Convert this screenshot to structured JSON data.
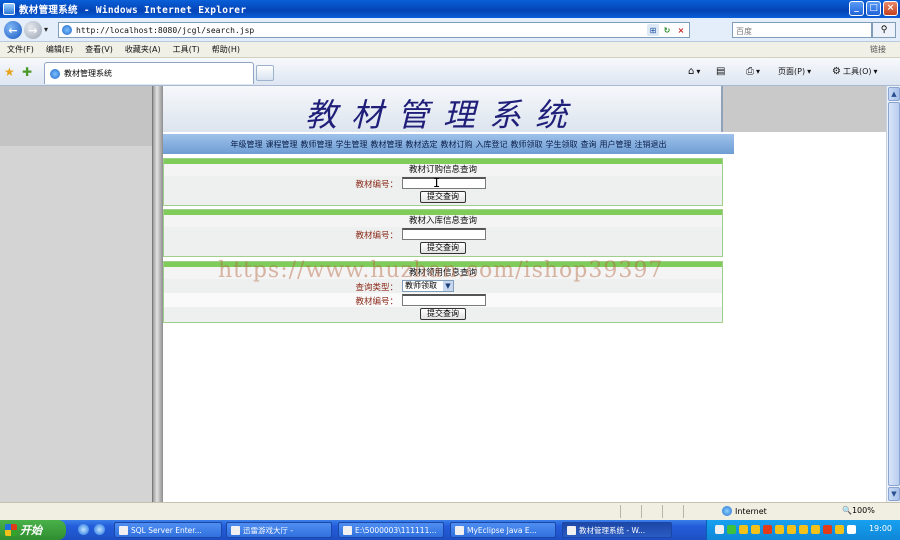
{
  "window": {
    "title": "教材管理系统 - Windows Internet Explorer",
    "minimize": "_",
    "maximize": "□",
    "close": "×"
  },
  "address": {
    "back": "←",
    "forward": "→",
    "dropdown": "▾",
    "url": "http://localhost:8080/jcgl/search.jsp",
    "search_placeholder": "百度",
    "search_button": "⚲",
    "refresh": "↻",
    "go": "→",
    "stop": "×",
    "compat": "⊞"
  },
  "menu": {
    "items": [
      "文件(F)",
      "编辑(E)",
      "查看(V)",
      "收藏夹(A)",
      "工具(T)",
      "帮助(H)"
    ],
    "links": "链接"
  },
  "tabs": {
    "active_label": "教材管理系统",
    "commands": {
      "home": "⌂",
      "feeds": "▤",
      "print": "⎙",
      "page": "页面(P)",
      "tools": "工具(O)"
    }
  },
  "site": {
    "title": "教材管理系统",
    "nav": [
      "年级管理",
      "课程管理",
      "教师管理",
      "学生管理",
      "教材管理",
      "教材选定",
      "教材订购",
      "入库登记",
      "教师领取",
      "学生领取",
      "查询",
      "用户管理",
      "注销退出"
    ]
  },
  "sections": {
    "order": {
      "title": "教材订购信息查询",
      "label": "教材编号：",
      "value": "",
      "button": "提交查询"
    },
    "stock": {
      "title": "教材入库信息查询",
      "label": "教材编号：",
      "value": "",
      "button": "提交查询"
    },
    "receive": {
      "title": "教材领用信息查询",
      "type_label": "查询类型：",
      "type_selected": "教师领取",
      "label": "教材编号：",
      "value": "",
      "button": "提交查询"
    }
  },
  "watermark": "https://www.huzhan.com/ishop39397",
  "status": {
    "zone": "Internet",
    "zoom": "100%"
  },
  "taskbar": {
    "start": "开始",
    "tasks": [
      "SQL Server Enter...",
      "迅雷游戏大厅 -",
      "E:\\5000003\\111111...",
      "MyEclipse Java E...",
      "教材管理系统 - W..."
    ],
    "clock": "19:00"
  },
  "colors": {
    "title_bar": "#0443b6",
    "section_bar": "#7fcc5a",
    "nav_bar": "#8fb5e3",
    "site_title": "#1f1f7a"
  }
}
